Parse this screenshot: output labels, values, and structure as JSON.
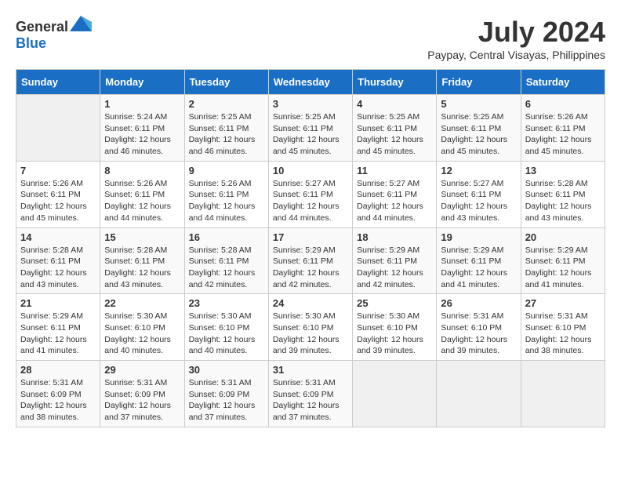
{
  "header": {
    "logo": {
      "general": "General",
      "blue": "Blue"
    },
    "title": "July 2024",
    "location": "Paypay, Central Visayas, Philippines"
  },
  "calendar": {
    "days_of_week": [
      "Sunday",
      "Monday",
      "Tuesday",
      "Wednesday",
      "Thursday",
      "Friday",
      "Saturday"
    ],
    "weeks": [
      [
        {
          "day": "",
          "info": ""
        },
        {
          "day": "1",
          "info": "Sunrise: 5:24 AM\nSunset: 6:11 PM\nDaylight: 12 hours and 46 minutes."
        },
        {
          "day": "2",
          "info": "Sunrise: 5:25 AM\nSunset: 6:11 PM\nDaylight: 12 hours and 46 minutes."
        },
        {
          "day": "3",
          "info": "Sunrise: 5:25 AM\nSunset: 6:11 PM\nDaylight: 12 hours and 45 minutes."
        },
        {
          "day": "4",
          "info": "Sunrise: 5:25 AM\nSunset: 6:11 PM\nDaylight: 12 hours and 45 minutes."
        },
        {
          "day": "5",
          "info": "Sunrise: 5:25 AM\nSunset: 6:11 PM\nDaylight: 12 hours and 45 minutes."
        },
        {
          "day": "6",
          "info": "Sunrise: 5:26 AM\nSunset: 6:11 PM\nDaylight: 12 hours and 45 minutes."
        }
      ],
      [
        {
          "day": "7",
          "info": "Sunrise: 5:26 AM\nSunset: 6:11 PM\nDaylight: 12 hours and 45 minutes."
        },
        {
          "day": "8",
          "info": "Sunrise: 5:26 AM\nSunset: 6:11 PM\nDaylight: 12 hours and 44 minutes."
        },
        {
          "day": "9",
          "info": "Sunrise: 5:26 AM\nSunset: 6:11 PM\nDaylight: 12 hours and 44 minutes."
        },
        {
          "day": "10",
          "info": "Sunrise: 5:27 AM\nSunset: 6:11 PM\nDaylight: 12 hours and 44 minutes."
        },
        {
          "day": "11",
          "info": "Sunrise: 5:27 AM\nSunset: 6:11 PM\nDaylight: 12 hours and 44 minutes."
        },
        {
          "day": "12",
          "info": "Sunrise: 5:27 AM\nSunset: 6:11 PM\nDaylight: 12 hours and 43 minutes."
        },
        {
          "day": "13",
          "info": "Sunrise: 5:28 AM\nSunset: 6:11 PM\nDaylight: 12 hours and 43 minutes."
        }
      ],
      [
        {
          "day": "14",
          "info": "Sunrise: 5:28 AM\nSunset: 6:11 PM\nDaylight: 12 hours and 43 minutes."
        },
        {
          "day": "15",
          "info": "Sunrise: 5:28 AM\nSunset: 6:11 PM\nDaylight: 12 hours and 43 minutes."
        },
        {
          "day": "16",
          "info": "Sunrise: 5:28 AM\nSunset: 6:11 PM\nDaylight: 12 hours and 42 minutes."
        },
        {
          "day": "17",
          "info": "Sunrise: 5:29 AM\nSunset: 6:11 PM\nDaylight: 12 hours and 42 minutes."
        },
        {
          "day": "18",
          "info": "Sunrise: 5:29 AM\nSunset: 6:11 PM\nDaylight: 12 hours and 42 minutes."
        },
        {
          "day": "19",
          "info": "Sunrise: 5:29 AM\nSunset: 6:11 PM\nDaylight: 12 hours and 41 minutes."
        },
        {
          "day": "20",
          "info": "Sunrise: 5:29 AM\nSunset: 6:11 PM\nDaylight: 12 hours and 41 minutes."
        }
      ],
      [
        {
          "day": "21",
          "info": "Sunrise: 5:29 AM\nSunset: 6:11 PM\nDaylight: 12 hours and 41 minutes."
        },
        {
          "day": "22",
          "info": "Sunrise: 5:30 AM\nSunset: 6:10 PM\nDaylight: 12 hours and 40 minutes."
        },
        {
          "day": "23",
          "info": "Sunrise: 5:30 AM\nSunset: 6:10 PM\nDaylight: 12 hours and 40 minutes."
        },
        {
          "day": "24",
          "info": "Sunrise: 5:30 AM\nSunset: 6:10 PM\nDaylight: 12 hours and 39 minutes."
        },
        {
          "day": "25",
          "info": "Sunrise: 5:30 AM\nSunset: 6:10 PM\nDaylight: 12 hours and 39 minutes."
        },
        {
          "day": "26",
          "info": "Sunrise: 5:31 AM\nSunset: 6:10 PM\nDaylight: 12 hours and 39 minutes."
        },
        {
          "day": "27",
          "info": "Sunrise: 5:31 AM\nSunset: 6:10 PM\nDaylight: 12 hours and 38 minutes."
        }
      ],
      [
        {
          "day": "28",
          "info": "Sunrise: 5:31 AM\nSunset: 6:09 PM\nDaylight: 12 hours and 38 minutes."
        },
        {
          "day": "29",
          "info": "Sunrise: 5:31 AM\nSunset: 6:09 PM\nDaylight: 12 hours and 37 minutes."
        },
        {
          "day": "30",
          "info": "Sunrise: 5:31 AM\nSunset: 6:09 PM\nDaylight: 12 hours and 37 minutes."
        },
        {
          "day": "31",
          "info": "Sunrise: 5:31 AM\nSunset: 6:09 PM\nDaylight: 12 hours and 37 minutes."
        },
        {
          "day": "",
          "info": ""
        },
        {
          "day": "",
          "info": ""
        },
        {
          "day": "",
          "info": ""
        }
      ]
    ]
  }
}
